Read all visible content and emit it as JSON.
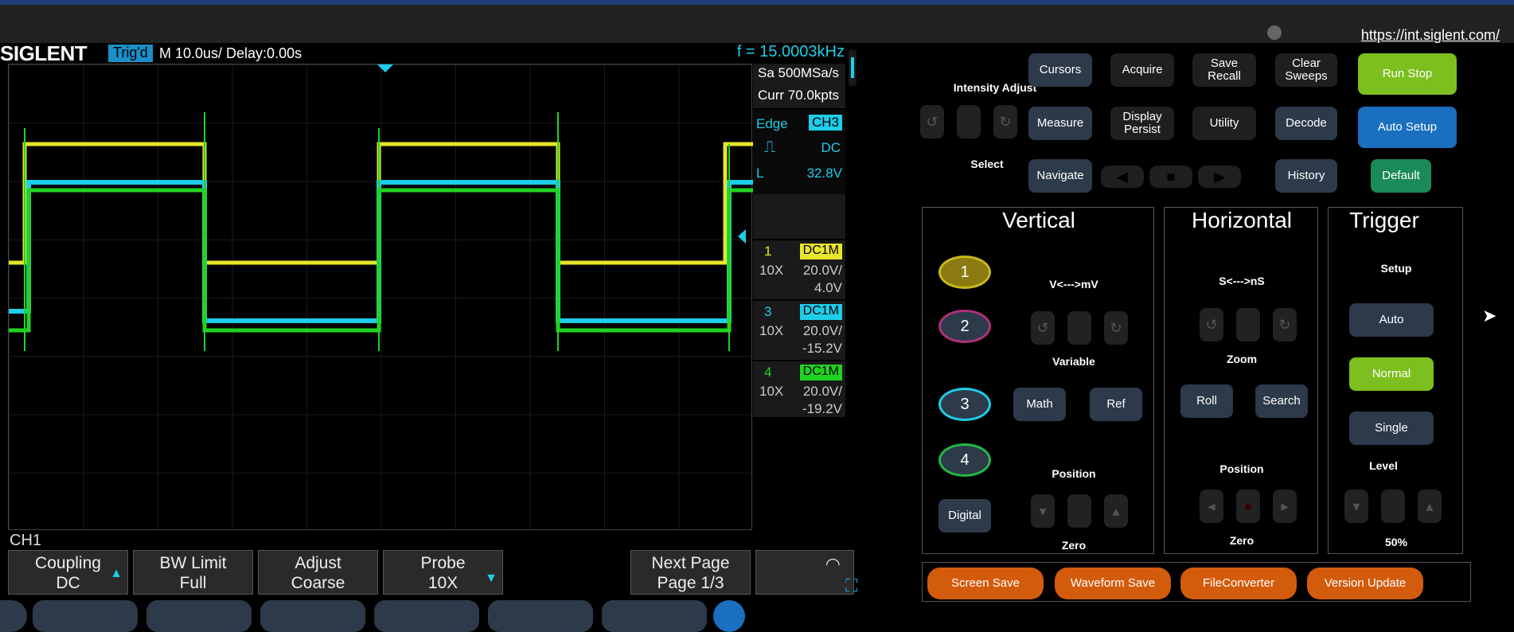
{
  "browser": {
    "url": "https://int.siglent.com/"
  },
  "scope": {
    "logo": "SIGLENT",
    "trig_status": "Trig'd",
    "timebase": "M 10.0us/  Delay:0.00s",
    "freq": "f = 15.0003kHz",
    "sample_rate": "Sa 500MSa/s",
    "curr_points": "Curr 70.0kpts",
    "trigger": {
      "type": "Edge",
      "source": "CH3",
      "coupling": "DC",
      "level_label": "L",
      "level": "32.8V"
    },
    "channels": [
      {
        "num": "1",
        "coupling": "DC1M",
        "probe": "10X",
        "scale": "20.0V/",
        "offset": "4.0V",
        "color": "#e6e62a"
      },
      {
        "num": "3",
        "coupling": "DC1M",
        "probe": "10X",
        "scale": "20.0V/",
        "offset": "-15.2V",
        "color": "#1ecde8"
      },
      {
        "num": "4",
        "coupling": "DC1M",
        "probe": "10X",
        "scale": "20.0V/",
        "offset": "-19.2V",
        "color": "#22d322"
      }
    ],
    "menu_channel": "CH1",
    "softkeys": [
      {
        "line1": "Coupling",
        "line2": "DC"
      },
      {
        "line1": "BW Limit",
        "line2": "Full"
      },
      {
        "line1": "Adjust",
        "line2": "Coarse"
      },
      {
        "line1": "Probe",
        "line2": "10X"
      },
      {
        "line1": "Next Page",
        "line2": "Page 1/3"
      }
    ]
  },
  "panel": {
    "intensity_adjust": "Intensity Adjust",
    "select": "Select",
    "buttons": {
      "cursors": "Cursors",
      "acquire": "Acquire",
      "save_recall": "Save Recall",
      "clear_sweeps": "Clear Sweeps",
      "run_stop": "Run Stop",
      "measure": "Measure",
      "display_persist": "Display Persist",
      "utility": "Utility",
      "decode": "Decode",
      "auto_setup": "Auto Setup",
      "navigate": "Navigate",
      "history": "History",
      "default": "Default"
    },
    "vertical": {
      "title": "Vertical",
      "v_mv": "V<--->mV",
      "variable": "Variable",
      "position": "Position",
      "zero": "Zero",
      "ch1": "1",
      "ch2": "2",
      "ch3": "3",
      "ch4": "4",
      "math": "Math",
      "ref": "Ref",
      "digital": "Digital"
    },
    "horizontal": {
      "title": "Horizontal",
      "s_ns": "S<--->nS",
      "zoom": "Zoom",
      "roll": "Roll",
      "search": "Search",
      "position": "Position",
      "zero": "Zero"
    },
    "trigger": {
      "title": "Trigger",
      "setup": "Setup",
      "auto": "Auto",
      "normal": "Normal",
      "single": "Single",
      "level": "Level",
      "pct": "50%"
    },
    "bottom": {
      "screen_save": "Screen Save",
      "waveform_save": "Waveform Save",
      "file_converter": "FileConverter",
      "version_update": "Version Update"
    }
  }
}
